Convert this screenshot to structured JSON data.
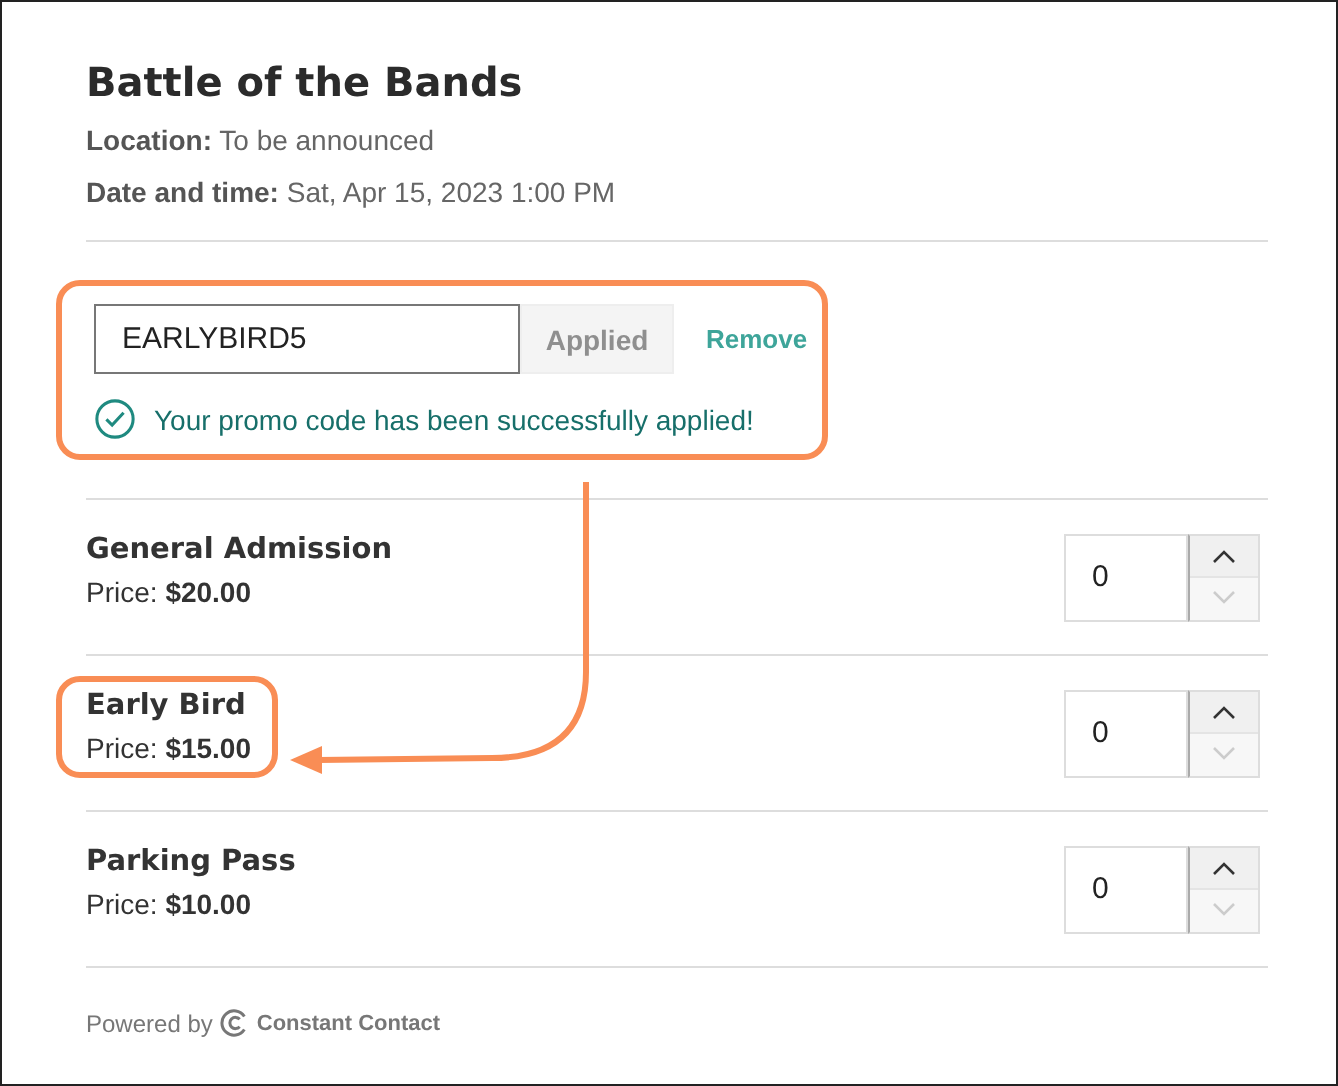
{
  "event": {
    "title": "Battle of the Bands",
    "details": [
      {
        "label": "Location:",
        "value": "To be announced"
      },
      {
        "label": "Date and time:",
        "value": "Sat, Apr 15, 2023 1:00 PM"
      }
    ]
  },
  "promo": {
    "value": "EARLYBIRD5",
    "button": "Applied",
    "button_disabled": true,
    "link": "Remove",
    "message": "Your promo code has been successfully applied!",
    "highlighted": true
  },
  "tickets": [
    {
      "name": "General Admission",
      "price_label": "Price:",
      "price": "$20.00",
      "quantity": "0",
      "highlighted": false,
      "decrement_disabled": true
    },
    {
      "name": "Early Bird",
      "price_label": "Price:",
      "price": "$15.00",
      "quantity": "0",
      "highlighted": true,
      "decrement_disabled": true
    },
    {
      "name": "Parking Pass",
      "price_label": "Price:",
      "price": "$10.00",
      "quantity": "0",
      "highlighted": false,
      "decrement_disabled": true
    }
  ],
  "annotation_arrow": true,
  "footer": {
    "powered_by": "Powered by",
    "brand": "Constant Contact"
  }
}
